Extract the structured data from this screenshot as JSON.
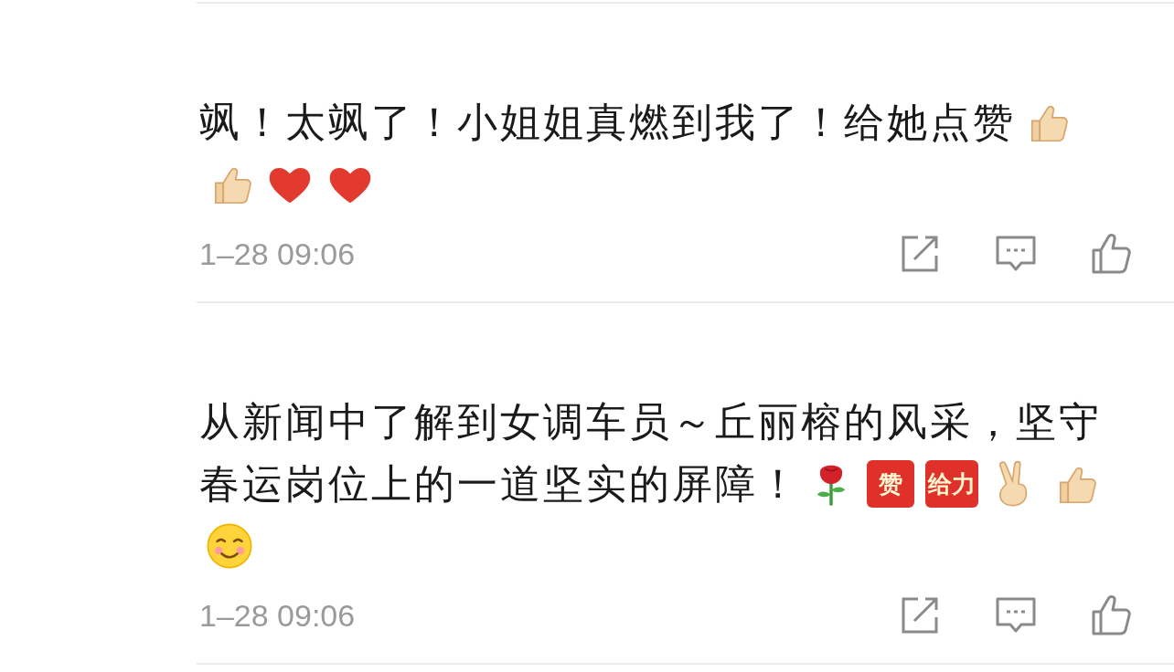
{
  "comments": [
    {
      "body": [
        {
          "kind": "text",
          "text": "飒！太飒了！小姐姐真燃到我了！给她点赞"
        },
        {
          "kind": "thumbs"
        },
        {
          "kind": "thumbs"
        },
        {
          "kind": "heart"
        },
        {
          "kind": "heart"
        }
      ],
      "time": "1–28 09:06"
    },
    {
      "body": [
        {
          "kind": "text",
          "text": "从新闻中了解到女调车员～丘丽榕的风采，坚守"
        },
        {
          "kind": "text",
          "text": "春运岗位上的一道坚实的屏障！"
        },
        {
          "kind": "rose"
        },
        {
          "kind": "sticker",
          "text": "赞"
        },
        {
          "kind": "sticker",
          "text": "给力"
        },
        {
          "kind": "victory"
        },
        {
          "kind": "thumbs"
        },
        {
          "kind": "smile"
        }
      ],
      "time": "1–28 09:06"
    }
  ]
}
